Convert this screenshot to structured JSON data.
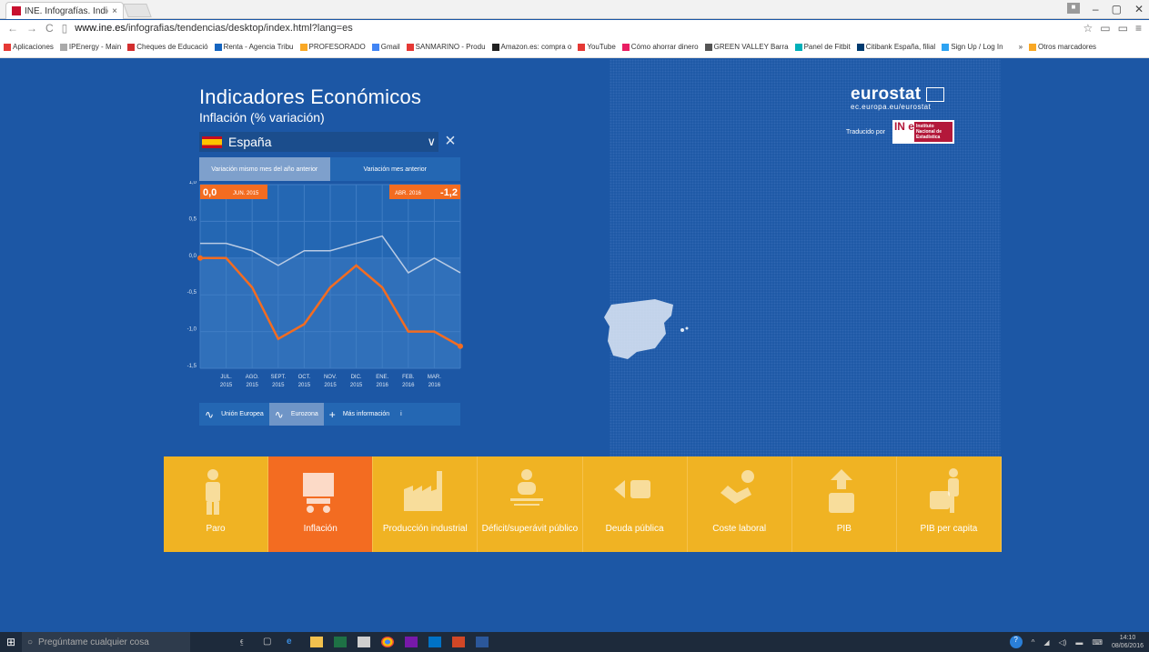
{
  "browser": {
    "tab_title": "INE. Infografías. Indicado",
    "tab_close": "×",
    "url_domain": "www.ine.es",
    "url_path": "/infografias/tendencias/desktop/index.html?lang=es",
    "bookmarks": [
      {
        "label": "Aplicaciones",
        "color": "#e53935"
      },
      {
        "label": "IPEnergy - Main",
        "color": "#aaaaaa"
      },
      {
        "label": "Cheques de Educació",
        "color": "#d32f2f"
      },
      {
        "label": "Renta - Agencia Tribu",
        "color": "#1565c0"
      },
      {
        "label": "PROFESORADO",
        "color": "#f9a825"
      },
      {
        "label": "Gmail",
        "color": "#4285f4"
      },
      {
        "label": "SANMARINO - Produ",
        "color": "#e53935"
      },
      {
        "label": "Amazon.es: compra o",
        "color": "#222222"
      },
      {
        "label": "YouTube",
        "color": "#e53935"
      },
      {
        "label": "Cómo ahorrar dinero",
        "color": "#e91e63"
      },
      {
        "label": "GREEN VALLEY Barra",
        "color": "#555555"
      },
      {
        "label": "Panel de Fitbit",
        "color": "#00b0b9"
      },
      {
        "label": "Citibank España, filial",
        "color": "#003b70"
      },
      {
        "label": "Sign Up / Log In",
        "color": "#2ea3f2"
      },
      {
        "label": "»",
        "color": "#ffffff"
      },
      {
        "label": "Otros marcadores",
        "color": "#f9a825"
      }
    ]
  },
  "header": {
    "title": "Indicadores Económicos",
    "subtitle": "Inflación (% variación)"
  },
  "eurostat": {
    "name": "eurostat",
    "url": "ec.europa.eu/eurostat",
    "translated_by": "Traducido por",
    "ine_mark": "IN e",
    "ine_text": "Instituto Nacional de Estadística"
  },
  "country_select": {
    "value": "España",
    "chevron": "∨",
    "close": "×"
  },
  "tabs": {
    "yearly": "Variación mismo mes del año anterior",
    "monthly": "Variación mes anterior"
  },
  "chart_data": {
    "type": "line",
    "ylim": [
      -1.5,
      1.0
    ],
    "yticks": [
      "1,0",
      "0,5",
      "0,0",
      "-0,5",
      "-1,0",
      "-1,5"
    ],
    "ytick_values": [
      1.0,
      0.5,
      0.0,
      -0.5,
      -1.0,
      -1.5
    ],
    "categories": [
      "JUN. 2015",
      "JUL. 2015",
      "AGO. 2015",
      "SEPT. 2015",
      "OCT. 2015",
      "NOV. 2015",
      "DIC. 2015",
      "ENE. 2016",
      "FEB. 2016",
      "MAR. 2016",
      "ABR. 2016"
    ],
    "tick_labels": [
      {
        "m": "JUL.",
        "y": "2015"
      },
      {
        "m": "AGO.",
        "y": "2015"
      },
      {
        "m": "SEPT.",
        "y": "2015"
      },
      {
        "m": "OCT.",
        "y": "2015"
      },
      {
        "m": "NOV.",
        "y": "2015"
      },
      {
        "m": "DIC.",
        "y": "2015"
      },
      {
        "m": "ENE.",
        "y": "2016"
      },
      {
        "m": "FEB.",
        "y": "2016"
      },
      {
        "m": "MAR.",
        "y": "2016"
      }
    ],
    "series": [
      {
        "color": "#f36c21",
        "values": [
          0.0,
          0.0,
          -0.4,
          -1.1,
          -0.9,
          -0.4,
          -0.1,
          -0.4,
          -1.0,
          -1.0,
          -1.2
        ]
      },
      {
        "color": "#b9cbe4",
        "values": [
          0.2,
          0.2,
          0.1,
          -0.1,
          0.1,
          0.1,
          0.2,
          0.3,
          -0.2,
          0.0,
          -0.2
        ]
      }
    ],
    "start_value": "0,0",
    "start_date": "JUN. 2015",
    "end_date": "ABR. 2016",
    "end_value": "-1,2",
    "highlight_color": "#f36c21"
  },
  "legend": {
    "eu": "Unión Europea",
    "eurozone": "Eurozona",
    "more": "Más información",
    "info": "i",
    "plus": "+"
  },
  "cards": [
    {
      "label": "Paro",
      "icon": "worker-icon",
      "active": false
    },
    {
      "label": "Inflación",
      "icon": "cart-icon",
      "active": true
    },
    {
      "label": "Producción industrial",
      "icon": "factory-icon",
      "active": false
    },
    {
      "label": "Déficit/superávit público",
      "icon": "scale-icon",
      "active": false
    },
    {
      "label": "Deuda pública",
      "icon": "debt-icon",
      "active": false
    },
    {
      "label": "Coste laboral",
      "icon": "wrench-hand-icon",
      "active": false
    },
    {
      "label": "PIB",
      "icon": "pib-up-icon",
      "active": false
    },
    {
      "label": "PIB per capita",
      "icon": "person-box-icon",
      "active": false
    }
  ],
  "taskbar": {
    "search": "Pregúntame cualquier cosa",
    "time": "14:10",
    "date": "08/06/2016"
  }
}
